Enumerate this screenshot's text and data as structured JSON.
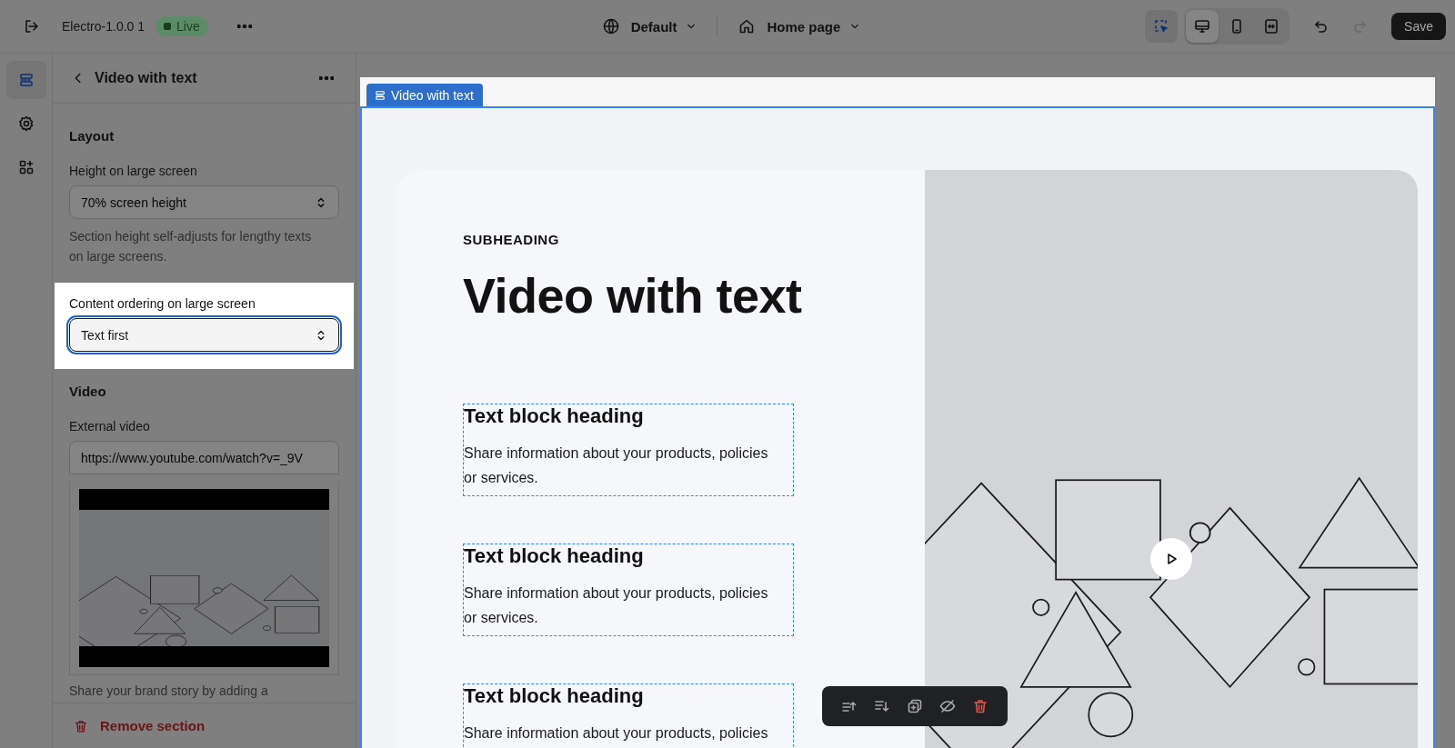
{
  "top_bar": {
    "theme_name": "Electro-1.0.0 1",
    "status_badge": "Live",
    "language": "Default",
    "page": "Home page",
    "inspector_active": true,
    "view_modes": [
      {
        "kind": "desktop",
        "selected": true
      },
      {
        "kind": "mobile",
        "selected": false
      },
      {
        "kind": "fullwidth",
        "selected": false
      }
    ],
    "save_button": "Save"
  },
  "sidebar": {
    "items": [
      {
        "kind": "sections",
        "selected": true
      },
      {
        "kind": "settings",
        "selected": false
      },
      {
        "kind": "apps",
        "selected": false
      }
    ]
  },
  "panel": {
    "title": "Video with text",
    "items": [
      {
        "kind": "heading",
        "text": "Layout"
      },
      {
        "kind": "select",
        "label": "Height on large screen",
        "value": "70% screen height",
        "highlighted": false
      },
      {
        "kind": "help",
        "text": "Section height self-adjusts for lengthy texts on large screens."
      },
      {
        "kind": "select",
        "label": "Content ordering on large screen",
        "value": "Text first",
        "highlighted": true
      },
      {
        "kind": "heading",
        "text": "Video"
      },
      {
        "kind": "input",
        "label": "External video",
        "value": "https://www.youtube.com/watch?v=_9V",
        "highlighted": false
      },
      {
        "kind": "video"
      },
      {
        "kind": "help",
        "text": "Share your brand story by adding a"
      }
    ],
    "remove_button": "Remove section"
  },
  "preview": {
    "section_label": "Video with text",
    "subheading": "SUBHEADING",
    "heading": "Video with text",
    "blocks": [
      {
        "heading": "Text block heading",
        "text": "Share information about your products, policies or services."
      },
      {
        "heading": "Text block heading",
        "text": "Share information about your products, policies or services."
      },
      {
        "heading": "Text block heading",
        "text": "Share information about your products, policies"
      }
    ],
    "toolbar": [
      {
        "kind": "move_up"
      },
      {
        "kind": "move_down"
      },
      {
        "kind": "duplicate"
      },
      {
        "kind": "hide"
      },
      {
        "kind": "delete"
      }
    ]
  }
}
